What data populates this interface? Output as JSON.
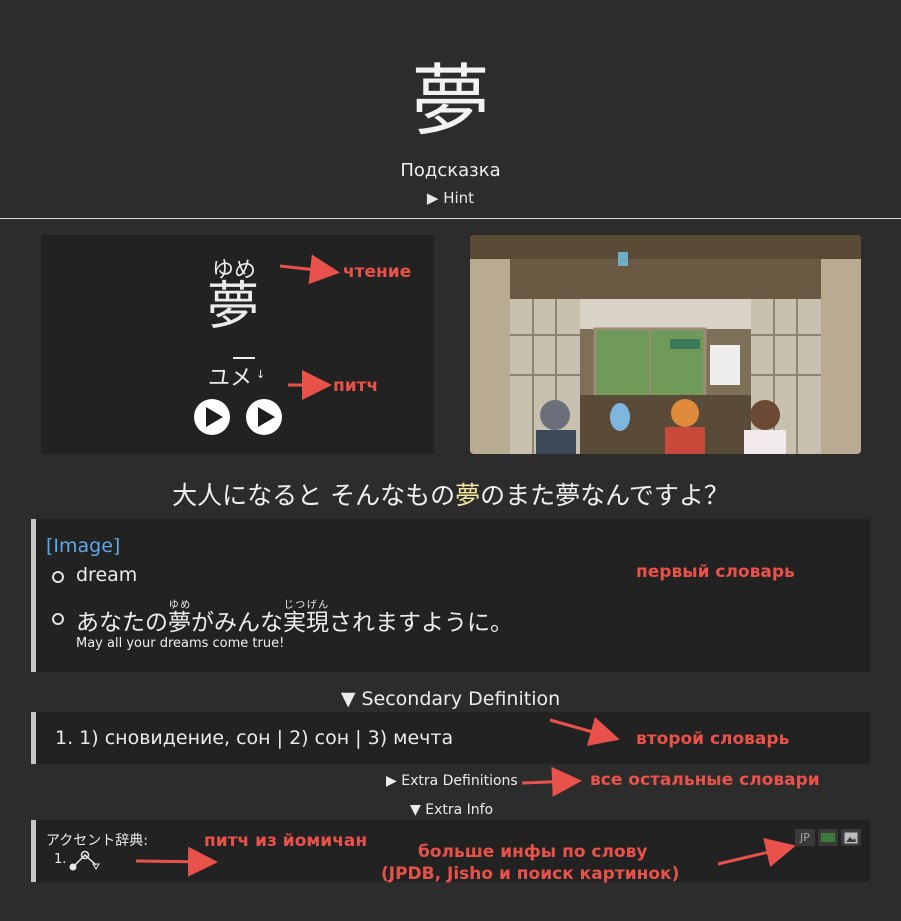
{
  "header": {
    "word": "夢",
    "hint_title": "Подсказка",
    "hint_toggle": "▶ Hint"
  },
  "card": {
    "furigana": "ゆめ",
    "word": "夢",
    "pitch_reading": "ユメ",
    "pitch_drop_mark": "↓"
  },
  "sentence": {
    "before": "大人になると そんなもの",
    "highlight": "夢",
    "after": "のまた夢なんですよ？"
  },
  "definition_primary": {
    "image_link": "[Image]",
    "gloss": "dream",
    "example_parts": [
      {
        "text": "あなたの"
      },
      {
        "text": "夢",
        "ruby": "ゆめ"
      },
      {
        "text": "がみんな"
      },
      {
        "text": "実現",
        "ruby": "じつげん"
      },
      {
        "text": "されますように。"
      }
    ],
    "example_en": "May all your dreams come true!"
  },
  "definition_secondary": {
    "toggle": "▼ Secondary Definition",
    "text": "1. 1) сновидение, сон | 2) сон | 3) мечта"
  },
  "extra_definitions_toggle": "▶ Extra Definitions",
  "extra_info": {
    "toggle": "▼ Extra Info",
    "accent_label": "アクセント辞典:",
    "accent_number": "1.",
    "buttons": [
      {
        "label": "JP",
        "icon": "jpdb-icon"
      },
      {
        "label": "",
        "icon": "jisho-icon",
        "color": "#3f7a3a"
      },
      {
        "label": "",
        "icon": "image-search-icon"
      }
    ]
  },
  "annotations": {
    "reading": "чтение",
    "pitch": "питч",
    "first_dictionary": "первый словарь",
    "second_dictionary": "второй словарь",
    "other_dictionaries": "все остальные словари",
    "yomichan_pitch": "питч из йомичан",
    "more_info_line1": "больше инфы по слову",
    "more_info_line2": "(JPDB, Jisho и поиск картинок)"
  },
  "colors": {
    "background": "#2c2c2c",
    "panel": "#222222",
    "highlight": "#f2e6a0",
    "link": "#5fa8e8",
    "annotation": "#e9524a"
  }
}
